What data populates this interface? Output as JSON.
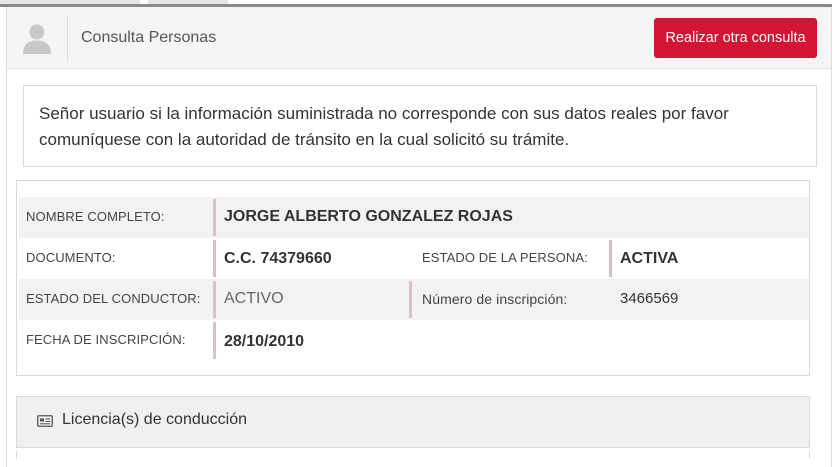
{
  "header": {
    "title": "Consulta Personas",
    "action_button": "Realizar otra consulta",
    "avatar_icon": "user-silhouette-icon",
    "accent_color": "#d31432"
  },
  "notice": {
    "text": "Señor usuario si la información suministrada no corresponde con sus datos reales por favor comuníquese con la autoridad de tránsito en la cual solicitó su trámite."
  },
  "person": {
    "nombre_label": "NOMBRE COMPLETO:",
    "nombre_value": "JORGE ALBERTO GONZALEZ ROJAS",
    "documento_label": "DOCUMENTO:",
    "documento_value": "C.C. 74379660",
    "estado_persona_label": "ESTADO DE LA PERSONA:",
    "estado_persona_value": "ACTIVA",
    "estado_conductor_label": "ESTADO DEL CONDUCTOR:",
    "estado_conductor_value": "ACTIVO",
    "inscripcion_num_label": "Número de inscripción:",
    "inscripcion_num_value": "3466569",
    "fecha_inscripcion_label": "FECHA DE INSCRIPCIÓN:",
    "fecha_inscripcion_value": "28/10/2010"
  },
  "licencias": {
    "label": "Licencia(s) de conducción",
    "icon": "id-card-icon"
  }
}
